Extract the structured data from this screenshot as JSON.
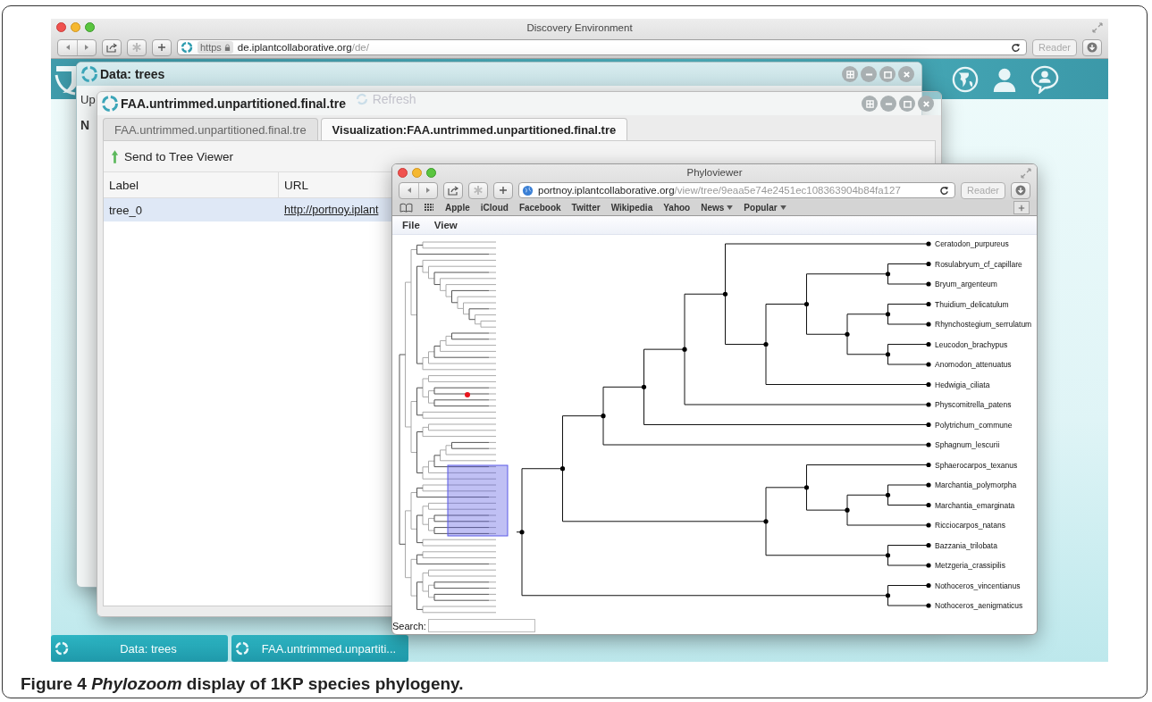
{
  "browser": {
    "title": "Discovery Environment",
    "scheme": "https",
    "host": "de.iplantcollaborative.org",
    "path": "/de/",
    "reader": "Reader"
  },
  "data_window": {
    "title": "Data: trees",
    "toolbar_item": "Up",
    "refresh": "Refresh",
    "column": "N"
  },
  "file_window": {
    "title": "FAA.untrimmed.unpartitioned.final.tre",
    "tabs": [
      {
        "label": "FAA.untrimmed.unpartitioned.final.tre",
        "selected": false
      },
      {
        "label": "Visualization:FAA.untrimmed.unpartitioned.final.tre",
        "selected": true
      }
    ],
    "action": "Send to Tree Viewer",
    "columns": [
      "Label",
      "URL"
    ],
    "rows": [
      {
        "cells": [
          "tree_0",
          "http://portnoy.iplant"
        ],
        "selected": true
      }
    ]
  },
  "viewer": {
    "title": "Phyloviewer",
    "host": "portnoy.iplantcollaborative.org",
    "path": "/view/tree/9eaa5e74e2451ec108363904b84fa127",
    "reader": "Reader",
    "bookmarks": [
      {
        "label": "Apple",
        "dropdown": false
      },
      {
        "label": "iCloud",
        "dropdown": false
      },
      {
        "label": "Facebook",
        "dropdown": false
      },
      {
        "label": "Twitter",
        "dropdown": false
      },
      {
        "label": "Wikipedia",
        "dropdown": false
      },
      {
        "label": "Yahoo",
        "dropdown": false
      },
      {
        "label": "News",
        "dropdown": true
      },
      {
        "label": "Popular",
        "dropdown": true
      }
    ],
    "menus": [
      "File",
      "View"
    ],
    "tree": {
      "children": [
        {
          "children": [
            {
              "children": [
                {
                  "children": [
                    {
                      "children": [
                        {
                          "children": [
                            {
                              "label": "Ceratodon_purpureus"
                            },
                            {
                              "children": [
                                {
                                  "children": [
                                    {
                                      "children": [
                                        {
                                          "label": "Rosulabryum_cf_capillare"
                                        },
                                        {
                                          "label": "Bryum_argenteum"
                                        }
                                      ]
                                    },
                                    {
                                      "children": [
                                        {
                                          "children": [
                                            {
                                              "label": "Thuidium_delicatulum"
                                            },
                                            {
                                              "label": "Rhynchostegium_serrulatum"
                                            }
                                          ]
                                        },
                                        {
                                          "children": [
                                            {
                                              "label": "Leucodon_brachypus"
                                            },
                                            {
                                              "label": "Anomodon_attenuatus"
                                            }
                                          ]
                                        }
                                      ]
                                    }
                                  ]
                                },
                                {
                                  "label": "Hedwigia_ciliata"
                                }
                              ]
                            }
                          ]
                        },
                        {
                          "label": "Physcomitrella_patens"
                        }
                      ]
                    },
                    {
                      "label": "Polytrichum_commune"
                    }
                  ]
                },
                {
                  "label": "Sphagnum_lescurii"
                }
              ]
            },
            {
              "children": [
                {
                  "children": [
                    {
                      "label": "Sphaerocarpos_texanus"
                    },
                    {
                      "children": [
                        {
                          "children": [
                            {
                              "label": "Marchantia_polymorpha"
                            },
                            {
                              "label": "Marchantia_emarginata"
                            }
                          ]
                        },
                        {
                          "label": "Ricciocarpos_natans"
                        }
                      ]
                    }
                  ]
                },
                {
                  "children": [
                    {
                      "label": "Bazzania_trilobata"
                    },
                    {
                      "label": "Metzgeria_crassipilis"
                    }
                  ]
                }
              ]
            }
          ]
        },
        {
          "children": [
            {
              "label": "Nothoceros_vincentianus"
            },
            {
              "label": "Nothoceros_aenigmaticus"
            }
          ]
        }
      ]
    },
    "search_label": "Search:"
  },
  "taskbar": [
    {
      "label": "Data: trees"
    },
    {
      "label": "FAA.untrimmed.unpartiti..."
    }
  ],
  "caption": "Figure 4 *Phylozoom* display of 1KP species phylogeny."
}
